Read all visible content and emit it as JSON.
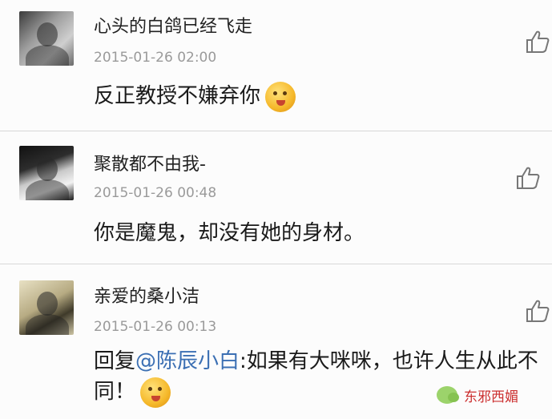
{
  "comments": [
    {
      "username": "心头的白鸽已经飞走",
      "time": "2015-01-26 02:00",
      "text": "反正教授不嫌弃你",
      "emoji": "smile-tongue-emoji"
    },
    {
      "username": "聚散都不由我-",
      "time": "2015-01-26 00:48",
      "text": "你是魔鬼，却没有她的身材。"
    },
    {
      "username": "亲爱的桑小洁",
      "time": "2015-01-26 00:13",
      "reply_prefix": "回复",
      "mention": "@陈辰小白",
      "reply_text": ":如果有大咪咪，也许人生从此不同！",
      "emoji": "smile-emoji"
    }
  ],
  "watermark": {
    "brand": "东邪西媚"
  },
  "colors": {
    "mention": "#3b6fb3",
    "divider": "#d8d8d8",
    "timestamp": "#9a9a9a",
    "watermark_text": "#cc3030"
  }
}
